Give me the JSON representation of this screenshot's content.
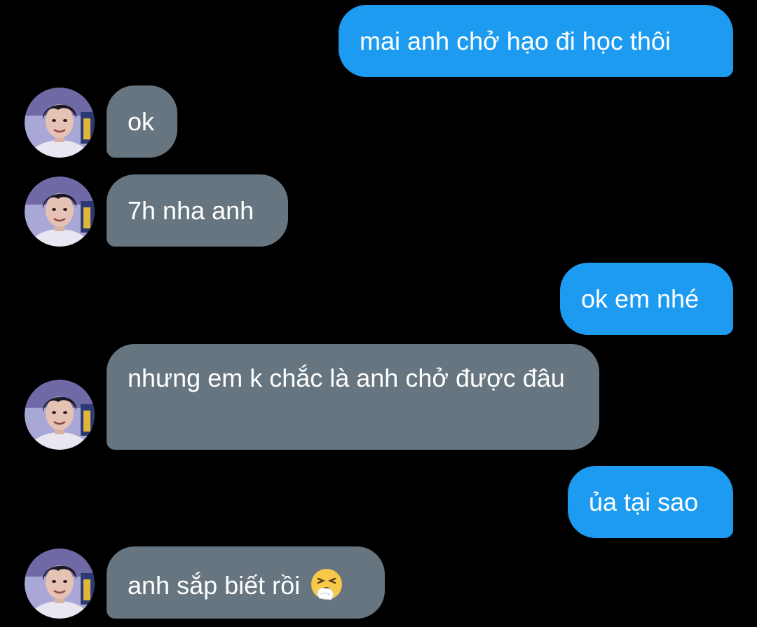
{
  "conversation": {
    "messages": [
      {
        "direction": "outgoing",
        "text": "mai anh chở hạo đi học thôi"
      },
      {
        "direction": "incoming",
        "text": "ok"
      },
      {
        "direction": "incoming",
        "text": "7h nha anh"
      },
      {
        "direction": "outgoing",
        "text": "ok em nhé"
      },
      {
        "direction": "incoming",
        "text": "nhưng em k chắc là anh chở được đâu"
      },
      {
        "direction": "outgoing",
        "text": "ủa tại sao"
      },
      {
        "direction": "incoming",
        "text": "anh sắp biết rồi",
        "emoji": "sneezing-face-emoji"
      }
    ]
  },
  "colors": {
    "background": "#000000",
    "outgoing_bubble": "#1d9bf0",
    "incoming_bubble": "#66757f",
    "text": "#ffffff"
  },
  "icons": {
    "avatar": "contact-avatar-photo",
    "emoji": "sneezing-face-emoji"
  }
}
